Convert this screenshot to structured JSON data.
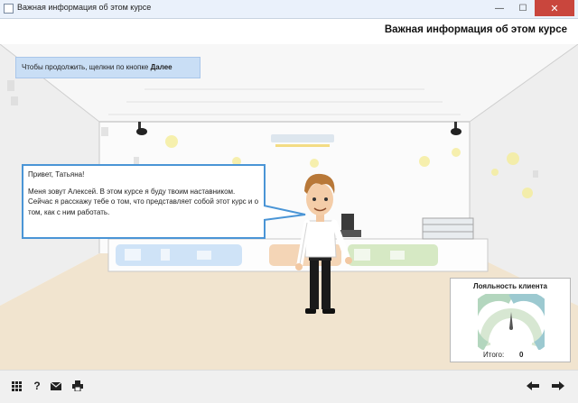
{
  "window": {
    "title": "Важная информация об этом курсе",
    "minimize_glyph": "—",
    "maximize_glyph": "☐",
    "close_glyph": "✕"
  },
  "header": {
    "course_title": "Важная информация об этом курсе"
  },
  "hint": {
    "text_prefix": "Чтобы продолжить, щелкни по кнопке ",
    "text_bold": "Далее"
  },
  "dialog": {
    "greeting": "Привет, Татьяна!",
    "body": "Меня зовут Алексей. В этом курсе я буду твоим наставником. Сейчас я расскажу тебе о том, что представляет собой этот курс и о том, как с ним работать."
  },
  "loyalty": {
    "title": "Лояльность клиента",
    "total_label": "Итого:",
    "total_value": "0"
  },
  "toolbar": {
    "menu_icon": "grid-icon",
    "help_glyph": "?",
    "mail_icon": "mail-icon",
    "print_icon": "printer-icon",
    "back_icon": "arrow-left-icon",
    "next_icon": "arrow-right-icon"
  },
  "colors": {
    "accent_blue": "#4a95d6",
    "hint_bg": "#c9def5",
    "close_red": "#c9463d",
    "floor": "#f1e4cf"
  }
}
